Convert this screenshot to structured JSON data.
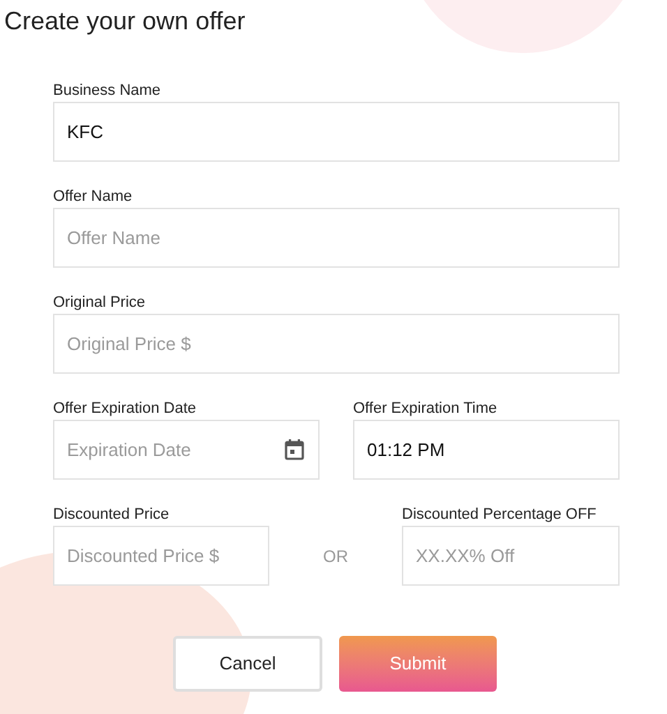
{
  "title": "Create your own offer",
  "business_name": {
    "label": "Business Name",
    "value": "KFC"
  },
  "offer_name": {
    "label": "Offer Name",
    "placeholder": "Offer Name"
  },
  "original_price": {
    "label": "Original Price",
    "placeholder": "Original Price $"
  },
  "expiration_date": {
    "label": "Offer Expiration Date",
    "placeholder": "Expiration Date"
  },
  "expiration_time": {
    "label": "Offer Expiration Time",
    "value": "01:12 PM"
  },
  "discounted_price": {
    "label": "Discounted Price",
    "placeholder": "Discounted Price $"
  },
  "separator": "OR",
  "discount_percentage": {
    "label": "Discounted Percentage OFF",
    "placeholder": "XX.XX% Off"
  },
  "buttons": [
    {
      "label": "Cancel",
      "kind": "secondary"
    },
    {
      "label": "Submit",
      "kind": "primary"
    }
  ]
}
